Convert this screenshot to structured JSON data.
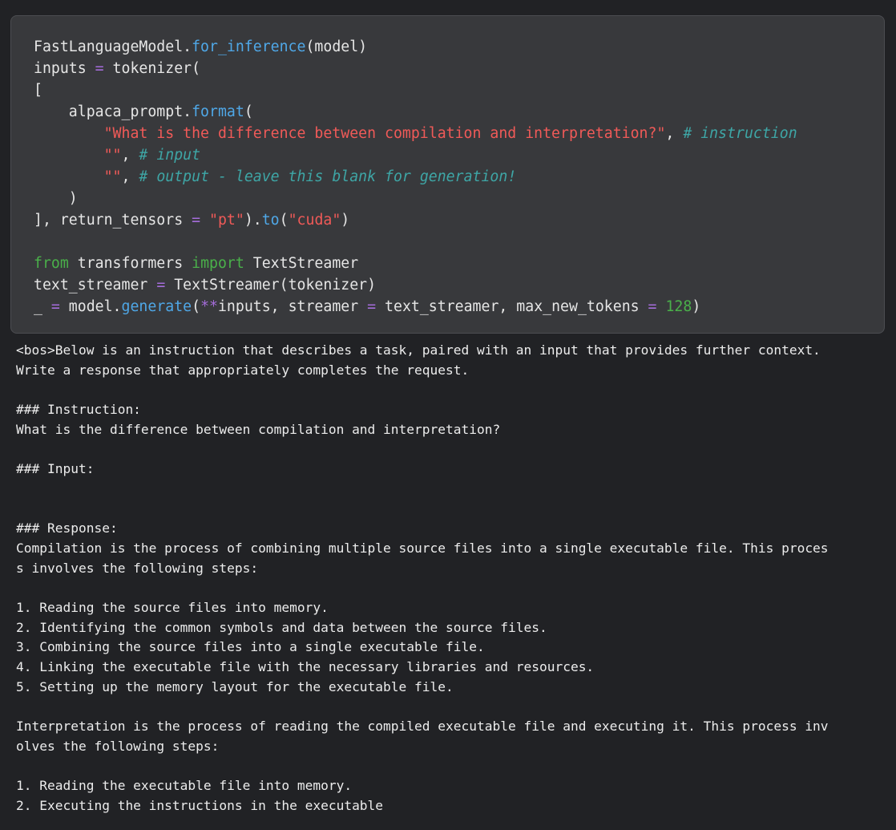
{
  "code_cell": {
    "lines": [
      [
        {
          "t": "FastLanguageModel.",
          "c": "plain"
        },
        {
          "t": "for_inference",
          "c": "fn"
        },
        {
          "t": "(model)",
          "c": "plain"
        }
      ],
      [
        {
          "t": "inputs ",
          "c": "plain"
        },
        {
          "t": "=",
          "c": "op"
        },
        {
          "t": " tokenizer(",
          "c": "plain"
        }
      ],
      [
        {
          "t": "[",
          "c": "plain"
        }
      ],
      [
        {
          "t": "    alpaca_prompt.",
          "c": "plain"
        },
        {
          "t": "format",
          "c": "fn"
        },
        {
          "t": "(",
          "c": "plain"
        }
      ],
      [
        {
          "t": "        ",
          "c": "plain"
        },
        {
          "t": "\"What is the difference between compilation and interpretation?\"",
          "c": "str"
        },
        {
          "t": ", ",
          "c": "plain"
        },
        {
          "t": "# instruction",
          "c": "com"
        }
      ],
      [
        {
          "t": "        ",
          "c": "plain"
        },
        {
          "t": "\"\"",
          "c": "str"
        },
        {
          "t": ", ",
          "c": "plain"
        },
        {
          "t": "# input",
          "c": "com"
        }
      ],
      [
        {
          "t": "        ",
          "c": "plain"
        },
        {
          "t": "\"\"",
          "c": "str"
        },
        {
          "t": ", ",
          "c": "plain"
        },
        {
          "t": "# output - leave this blank for generation!",
          "c": "com"
        }
      ],
      [
        {
          "t": "    )",
          "c": "plain"
        }
      ],
      [
        {
          "t": "], return_tensors ",
          "c": "plain"
        },
        {
          "t": "=",
          "c": "op"
        },
        {
          "t": " ",
          "c": "plain"
        },
        {
          "t": "\"pt\"",
          "c": "str"
        },
        {
          "t": ").",
          "c": "plain"
        },
        {
          "t": "to",
          "c": "fn"
        },
        {
          "t": "(",
          "c": "plain"
        },
        {
          "t": "\"cuda\"",
          "c": "str"
        },
        {
          "t": ")",
          "c": "plain"
        }
      ],
      [],
      [
        {
          "t": "from",
          "c": "kw"
        },
        {
          "t": " transformers ",
          "c": "plain"
        },
        {
          "t": "import",
          "c": "kw"
        },
        {
          "t": " TextStreamer",
          "c": "plain"
        }
      ],
      [
        {
          "t": "text_streamer ",
          "c": "plain"
        },
        {
          "t": "=",
          "c": "op"
        },
        {
          "t": " TextStreamer(tokenizer)",
          "c": "plain"
        }
      ],
      [
        {
          "t": "_ ",
          "c": "plain"
        },
        {
          "t": "=",
          "c": "op"
        },
        {
          "t": " model.",
          "c": "plain"
        },
        {
          "t": "generate",
          "c": "fn"
        },
        {
          "t": "(",
          "c": "plain"
        },
        {
          "t": "**",
          "c": "op"
        },
        {
          "t": "inputs, streamer ",
          "c": "plain"
        },
        {
          "t": "=",
          "c": "op"
        },
        {
          "t": " text_streamer, max_new_tokens ",
          "c": "plain"
        },
        {
          "t": "=",
          "c": "op"
        },
        {
          "t": " ",
          "c": "plain"
        },
        {
          "t": "128",
          "c": "num"
        },
        {
          "t": ")",
          "c": "plain"
        }
      ]
    ]
  },
  "output": {
    "lines": [
      "<bos>Below is an instruction that describes a task, paired with an input that provides further context.",
      "Write a response that appropriately completes the request.",
      "",
      "### Instruction:",
      "What is the difference between compilation and interpretation?",
      "",
      "### Input:",
      "",
      "",
      "### Response:",
      "Compilation is the process of combining multiple source files into a single executable file. This proces",
      "s involves the following steps:",
      "",
      "1. Reading the source files into memory.",
      "2. Identifying the common symbols and data between the source files.",
      "3. Combining the source files into a single executable file.",
      "4. Linking the executable file with the necessary libraries and resources.",
      "5. Setting up the memory layout for the executable file.",
      "",
      "Interpretation is the process of reading the compiled executable file and executing it. This process inv",
      "olves the following steps:",
      "",
      "1. Reading the executable file into memory.",
      "2. Executing the instructions in the executable"
    ]
  },
  "colors": {
    "background": "#212225",
    "cell_background": "#38393c",
    "function": "#4fa8e8",
    "operator": "#a56ddb",
    "string": "#f05a58",
    "comment": "#3ea6a6",
    "keyword": "#4ab04a"
  }
}
